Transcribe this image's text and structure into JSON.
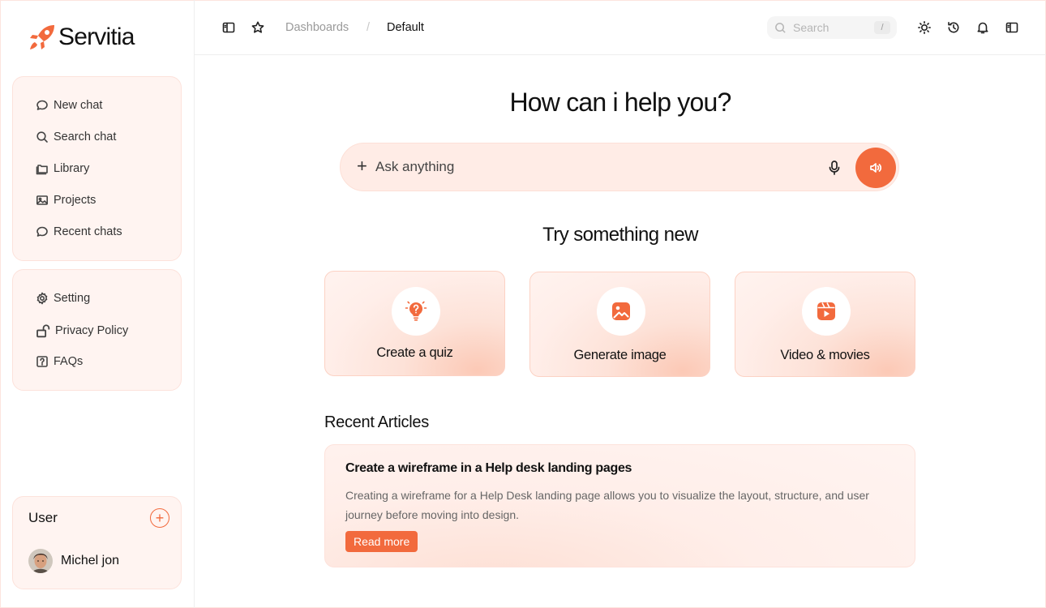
{
  "app": {
    "name": "Servitia",
    "accent": "#f26a3d"
  },
  "sidebar": {
    "primary_items": [
      {
        "label": "New chat",
        "icon": "chat-bubble-icon"
      },
      {
        "label": "Search chat",
        "icon": "search-icon"
      },
      {
        "label": "Library",
        "icon": "folder-icon"
      },
      {
        "label": "Projects",
        "icon": "image-icon"
      },
      {
        "label": "Recent chats",
        "icon": "chat-bubble-icon"
      }
    ],
    "secondary_items": [
      {
        "label": "Setting",
        "icon": "gear-icon"
      },
      {
        "label": "Privacy Policy",
        "icon": "unlock-icon"
      },
      {
        "label": "FAQs",
        "icon": "question-icon"
      }
    ],
    "user": {
      "title": "User",
      "name": "Michel jon",
      "add_icon": "plus-icon"
    }
  },
  "header": {
    "breadcrumb": {
      "parent": "Dashboards",
      "separator": "/",
      "current": "Default"
    },
    "search": {
      "placeholder": "Search",
      "shortcut": "/"
    }
  },
  "main": {
    "hero_title": "How can i help you?",
    "ask": {
      "placeholder": "Ask anything"
    },
    "suggestions_title": "Try something new",
    "suggestions": [
      {
        "label": "Create a quiz",
        "icon": "lightbulb-question-icon"
      },
      {
        "label": "Generate image",
        "icon": "image-icon"
      },
      {
        "label": "Video & movies",
        "icon": "video-play-icon"
      }
    ],
    "articles_title": "Recent Articles",
    "article": {
      "title": "Create a wireframe in a Help desk landing pages",
      "body": "Creating a wireframe for a Help Desk landing page allows you to visualize the layout, structure, and user journey before moving into design.",
      "cta": "Read more"
    }
  }
}
